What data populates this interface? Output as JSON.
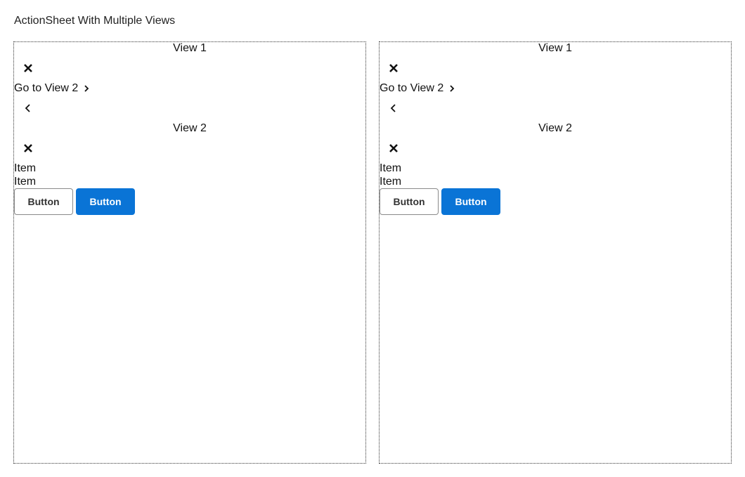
{
  "page": {
    "title": "ActionSheet With Multiple Views"
  },
  "panels": [
    {
      "view1": {
        "title": "View 1",
        "close_icon": "close-icon",
        "link_label": "Go to View 2",
        "link_icon": "chevron-right-icon"
      },
      "view2": {
        "back_icon": "chevron-left-icon",
        "title": "View 2",
        "close_icon": "close-icon",
        "items": [
          "Item",
          "Item"
        ],
        "buttons": {
          "secondary_label": "Button",
          "primary_label": "Button"
        }
      }
    },
    {
      "view1": {
        "title": "View 1",
        "close_icon": "close-icon",
        "link_label": "Go to View 2",
        "link_icon": "chevron-right-icon"
      },
      "view2": {
        "back_icon": "chevron-left-icon",
        "title": "View 2",
        "close_icon": "close-icon",
        "items": [
          "Item",
          "Item"
        ],
        "buttons": {
          "secondary_label": "Button",
          "primary_label": "Button"
        }
      }
    }
  ],
  "colors": {
    "primary_button": "#0a74d6",
    "secondary_border": "#8a8a8a",
    "text": "#111111"
  }
}
